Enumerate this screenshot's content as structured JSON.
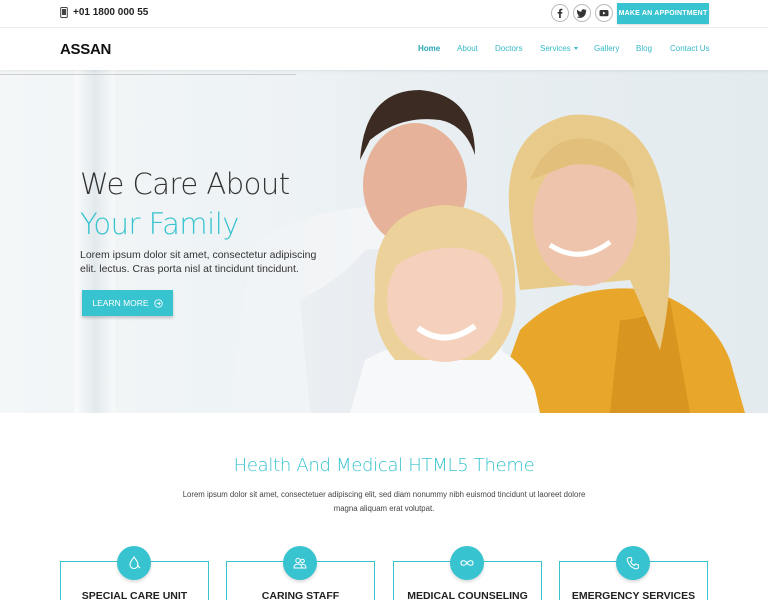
{
  "topbar": {
    "phone": "+01 1800 000 55",
    "social": [
      {
        "icon": "facebook-icon"
      },
      {
        "icon": "twitter-icon"
      },
      {
        "icon": "youtube-icon"
      }
    ],
    "appointment_label": "Make An Appointment"
  },
  "nav": {
    "logo": "ASSAN",
    "items": [
      "Home",
      "About",
      "Doctors",
      "Services",
      "Gallery",
      "Blog",
      "Contact Us"
    ],
    "active": "Home"
  },
  "hero": {
    "title_line1": "We Care About",
    "title_line2": "Your Family",
    "text": "Lorem ipsum dolor sit amet, consectetur adipiscing elit. lectus. Cras porta nisl at tincidunt tincidunt.",
    "button_label": "LEARN MORE"
  },
  "section": {
    "title": "Health And Medical HTML5 Theme",
    "text": "Lorem ipsum dolor sit amet, consectetuer adipiscing elit, sed diam nonummy nibh euismod tincidunt ut laoreet dolore magna aliquam erat volutpat."
  },
  "services": [
    {
      "title": "SPECIAL CARE UNIT",
      "icon": "drop-icon"
    },
    {
      "title": "CARING STAFF",
      "icon": "people-icon"
    },
    {
      "title": "MEDICAL COUNSELING",
      "icon": "infinity-icon"
    },
    {
      "title": "EMERGENCY SERVICES",
      "icon": "phone-icon"
    }
  ],
  "colors": {
    "accent": "#37c3cf",
    "text": "#333333"
  }
}
